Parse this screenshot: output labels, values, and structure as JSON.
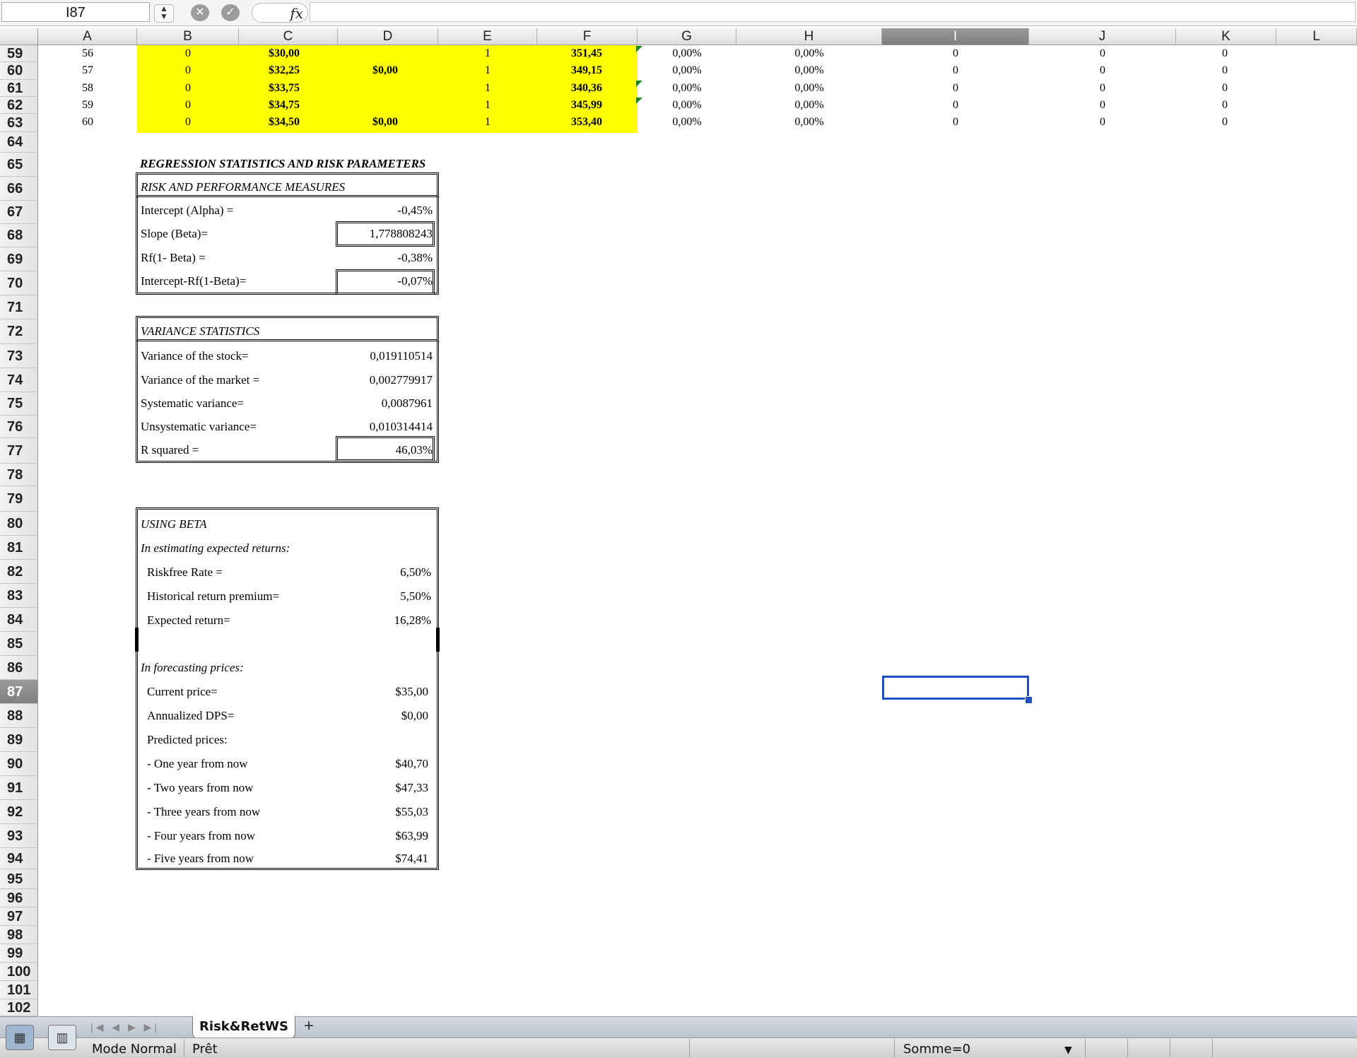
{
  "formula_bar": {
    "cell_ref": "I87",
    "fx_label": "fx",
    "formula": ""
  },
  "columns": [
    "A",
    "B",
    "C",
    "D",
    "E",
    "F",
    "G",
    "H",
    "I",
    "J",
    "K",
    "L"
  ],
  "selected_column": "I",
  "selected_row": "87",
  "rows": [
    "59",
    "60",
    "61",
    "62",
    "63",
    "64",
    "65",
    "66",
    "67",
    "68",
    "69",
    "70",
    "71",
    "72",
    "73",
    "74",
    "75",
    "76",
    "77",
    "78",
    "79",
    "80",
    "81",
    "82",
    "83",
    "84",
    "85",
    "86",
    "87",
    "88",
    "89",
    "90",
    "91",
    "92",
    "93",
    "94",
    "95",
    "96",
    "97",
    "98",
    "99",
    "100",
    "101",
    "102"
  ],
  "data_rows": [
    {
      "a": "56",
      "b": "0",
      "c": "$30,00",
      "d": "",
      "e": "1",
      "f": "351,45",
      "g": "0,00%",
      "h": "0,00%",
      "i": "0",
      "j": "0",
      "k": "0"
    },
    {
      "a": "57",
      "b": "0",
      "c": "$32,25",
      "d": "$0,00",
      "e": "1",
      "f": "349,15",
      "g": "0,00%",
      "h": "0,00%",
      "i": "0",
      "j": "0",
      "k": "0"
    },
    {
      "a": "58",
      "b": "0",
      "c": "$33,75",
      "d": "",
      "e": "1",
      "f": "340,36",
      "g": "0,00%",
      "h": "0,00%",
      "i": "0",
      "j": "0",
      "k": "0"
    },
    {
      "a": "59",
      "b": "0",
      "c": "$34,75",
      "d": "",
      "e": "1",
      "f": "345,99",
      "g": "0,00%",
      "h": "0,00%",
      "i": "0",
      "j": "0",
      "k": "0"
    },
    {
      "a": "60",
      "b": "0",
      "c": "$34,50",
      "d": "$0,00",
      "e": "1",
      "f": "353,40",
      "g": "0,00%",
      "h": "0,00%",
      "i": "0",
      "j": "0",
      "k": "0"
    }
  ],
  "section_title": "REGRESSION STATISTICS AND RISK PARAMETERS",
  "risk": {
    "title": "RISK AND PERFORMANCE MEASURES",
    "items": [
      {
        "label": "Intercept (Alpha) =",
        "value": "-0,45%"
      },
      {
        "label": "Slope (Beta)=",
        "value": "1,778808243"
      },
      {
        "label": "Rf(1- Beta) =",
        "value": "-0,38%"
      },
      {
        "label": "Intercept-Rf(1-Beta)=",
        "value": "-0,07%"
      }
    ]
  },
  "variance": {
    "title": "VARIANCE STATISTICS",
    "items": [
      {
        "label": "Variance of the stock=",
        "value": "0,019110514"
      },
      {
        "label": "Variance of the market =",
        "value": "0,002779917"
      },
      {
        "label": "Systematic variance=",
        "value": "0,0087961"
      },
      {
        "label": "Unsystematic variance=",
        "value": "0,010314414"
      },
      {
        "label": "R squared =",
        "value": "46,03%"
      }
    ]
  },
  "beta": {
    "title": "USING BETA",
    "subtitle1": "In estimating expected returns:",
    "returns": [
      {
        "label": "Riskfree Rate =",
        "value": "6,50%"
      },
      {
        "label": "Historical return premium=",
        "value": "5,50%"
      },
      {
        "label": "Expected return=",
        "value": "16,28%"
      }
    ],
    "subtitle2": "In forecasting prices:",
    "prices": [
      {
        "label": "Current price=",
        "value": "$35,00"
      },
      {
        "label": "Annualized DPS=",
        "value": "$0,00"
      },
      {
        "label": "Predicted prices:",
        "value": ""
      },
      {
        "label": "- One year from now",
        "value": "$40,70"
      },
      {
        "label": "- Two years from now",
        "value": "$47,33"
      },
      {
        "label": "- Three years from now",
        "value": "$55,03"
      },
      {
        "label": "- Four years from now",
        "value": "$63,99"
      },
      {
        "label": "- Five years from now",
        "value": "$74,41"
      }
    ]
  },
  "sheet_tab": "Risk&RetWS",
  "add_tab": "+",
  "status": {
    "mode": "Mode Normal",
    "state": "Prêt",
    "sum": "Somme=0"
  },
  "colors": {
    "highlight": "#ffff00",
    "selection": "#1f4fc0"
  }
}
